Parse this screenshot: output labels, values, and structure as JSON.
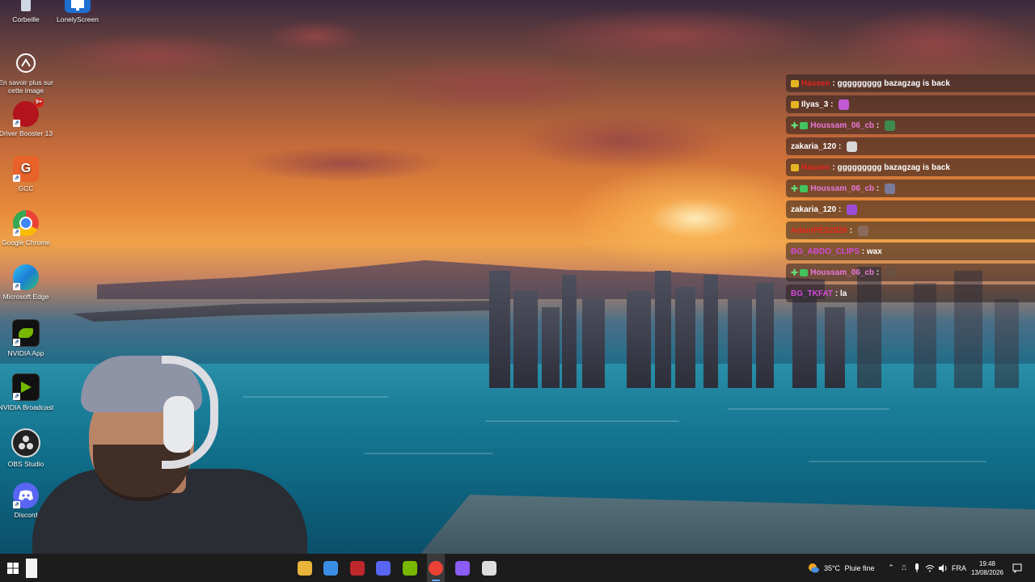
{
  "desktop": {
    "icons": [
      {
        "label": "Corbeille",
        "icon": "recycle-bin-icon"
      },
      {
        "label": "LonelyScreen",
        "icon": "monitor-icon"
      },
      {
        "label": "En savoir plus sur cette image",
        "icon": "camera-info-icon"
      },
      {
        "label": "Driver Booster 13",
        "icon": "driver-booster-icon",
        "badge": "9+"
      },
      {
        "label": "GCC",
        "icon": "gcc-icon"
      },
      {
        "label": "Google Chrome",
        "icon": "chrome-icon"
      },
      {
        "label": "Microsoft Edge",
        "icon": "edge-icon"
      },
      {
        "label": "NVIDIA App",
        "icon": "nvidia-icon"
      },
      {
        "label": "NVIDIA Broadcast",
        "icon": "nvidia-broadcast-icon"
      },
      {
        "label": "OBS Studio",
        "icon": "obs-icon"
      },
      {
        "label": "Discord",
        "icon": "discord-icon"
      }
    ]
  },
  "chat": {
    "messages": [
      {
        "user": "Hassen",
        "user_color": "#e0251b",
        "badge": "gold",
        "text": "ggggggggg bazagzag is back",
        "emote": ""
      },
      {
        "user": "Ilyas_3",
        "user_color": "#ffffff",
        "badge": "gold",
        "text": "",
        "emote": "#c25ad6"
      },
      {
        "user": "Houssam_06_cb",
        "user_color": "#e879d9",
        "badge": "green-plus",
        "text": "",
        "emote": "#3d8b4e"
      },
      {
        "user": "zakaria_120",
        "user_color": "#ffffff",
        "badge": "",
        "text": "",
        "emote": "#d8d8d8"
      },
      {
        "user": "Hassen",
        "user_color": "#e0251b",
        "badge": "gold",
        "text": "ggggggggg bazagzag is back",
        "emote": ""
      },
      {
        "user": "Houssam_06_cb",
        "user_color": "#e879d9",
        "badge": "green-plus",
        "text": "",
        "emote": "#7a7a9a"
      },
      {
        "user": "zakaria_120",
        "user_color": "#ffffff",
        "badge": "",
        "text": "",
        "emote": "#9b4bd6"
      },
      {
        "user": "AdamPES2026",
        "user_color": "#e0251b",
        "badge": "",
        "text": "",
        "emote": "#8a6a5a"
      },
      {
        "user": "BG_ABDO_CLIPS",
        "user_color": "#d34ad8",
        "badge": "",
        "text": "wax",
        "emote": ""
      },
      {
        "user": "Houssam_06_cb",
        "user_color": "#e879d9",
        "badge": "green-plus",
        "text": "",
        "emote": "#6a5040"
      },
      {
        "user": "BG_TKFAT",
        "user_color": "#d34ad8",
        "badge": "",
        "text": "la",
        "emote": ""
      }
    ],
    "separator": " : "
  },
  "taskbar": {
    "apps": [
      {
        "name": "file-explorer-icon",
        "color": "#e8b43a"
      },
      {
        "name": "microsoft-store-icon",
        "color": "#3a8ee6"
      },
      {
        "name": "driver-booster-taskbar-icon",
        "color": "#c0272d"
      },
      {
        "name": "discord-taskbar-icon",
        "color": "#5865f2"
      },
      {
        "name": "nvidia-broadcast-taskbar-icon",
        "color": "#76b900"
      },
      {
        "name": "chrome-taskbar-icon",
        "color": "#e94235"
      },
      {
        "name": "obs-taskbar-icon",
        "color": "#8b5cf6"
      },
      {
        "name": "screen-record-taskbar-icon",
        "color": "#dddddd"
      }
    ],
    "weather": {
      "temp": "35°C",
      "desc": "Pluie fine"
    },
    "language": "FRA",
    "time": "19:48",
    "date": "13/08/2026"
  }
}
